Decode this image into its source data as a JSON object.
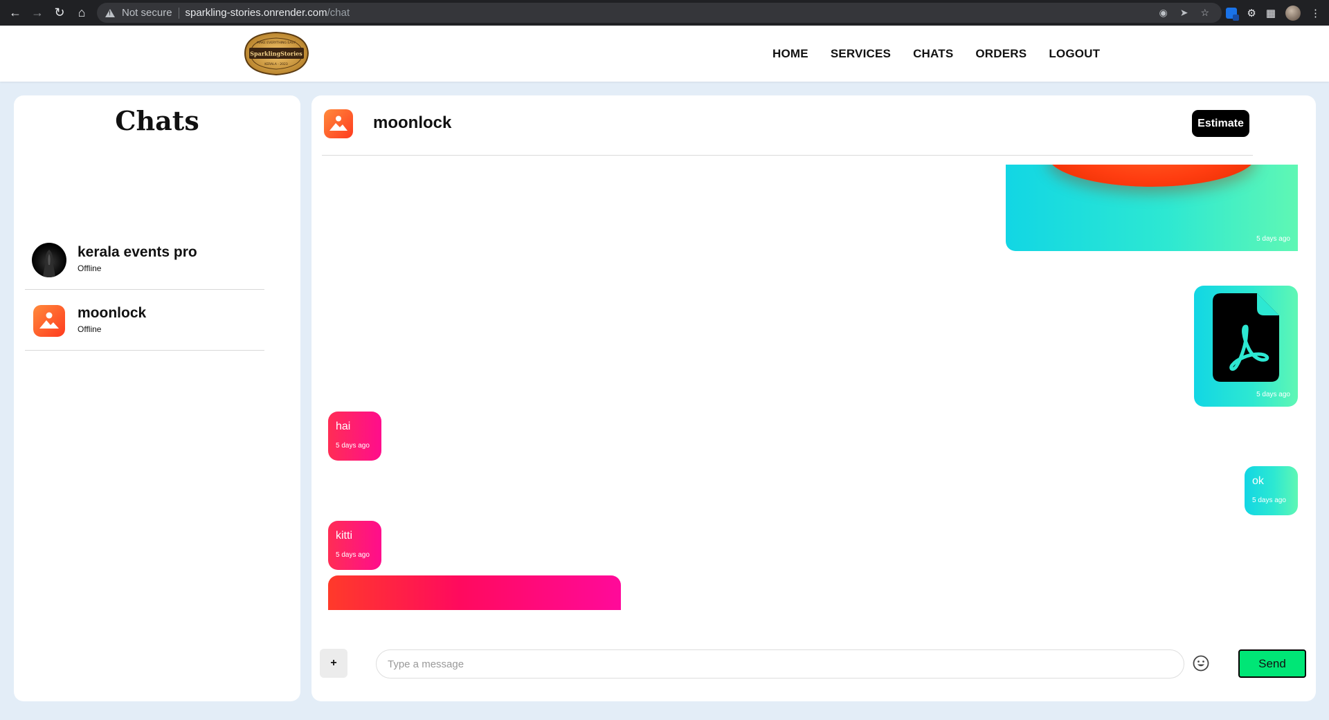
{
  "browser": {
    "security_label": "Not secure",
    "url_host": "sparkling-stories.onrender.com",
    "url_path": "/chat"
  },
  "site": {
    "logo": {
      "top_text": "MAKE EVERYTHING EASY",
      "name": "SparklingStories",
      "bottom_text": "KERALA - 2023"
    },
    "nav": [
      "HOME",
      "SERVICES",
      "CHATS",
      "ORDERS",
      "LOGOUT"
    ]
  },
  "chats": {
    "title": "Chats",
    "items": [
      {
        "name": "kerala events pro",
        "status": "Offline",
        "avatar": "dark-portrait-avatar"
      },
      {
        "name": "moonlock",
        "status": "Offline",
        "avatar": "orange-image-avatar"
      }
    ]
  },
  "conversation": {
    "contact_name": "moonlock",
    "estimate_label": "Estimate",
    "messages": [
      {
        "direction": "sent",
        "type": "image",
        "time": "5 days ago"
      },
      {
        "direction": "sent",
        "type": "pdf-file",
        "time": "5 days ago"
      },
      {
        "direction": "received",
        "type": "text",
        "text": "hai",
        "time": "5 days ago"
      },
      {
        "direction": "sent",
        "type": "text",
        "text": "ok",
        "time": "5 days ago"
      },
      {
        "direction": "received",
        "type": "text",
        "text": "kitti",
        "time": "5 days ago"
      },
      {
        "direction": "received",
        "type": "image",
        "time": ""
      }
    ],
    "composer": {
      "attach_label": "+",
      "placeholder": "Type a message",
      "send_label": "Send"
    }
  },
  "colors": {
    "sent_gradient": [
      "#12d6e4",
      "#5ff7b4"
    ],
    "received_gradient": [
      "#ff2d55",
      "#ff0d8c"
    ],
    "send_button": "#00e676",
    "page_background": "#e3edf7"
  }
}
